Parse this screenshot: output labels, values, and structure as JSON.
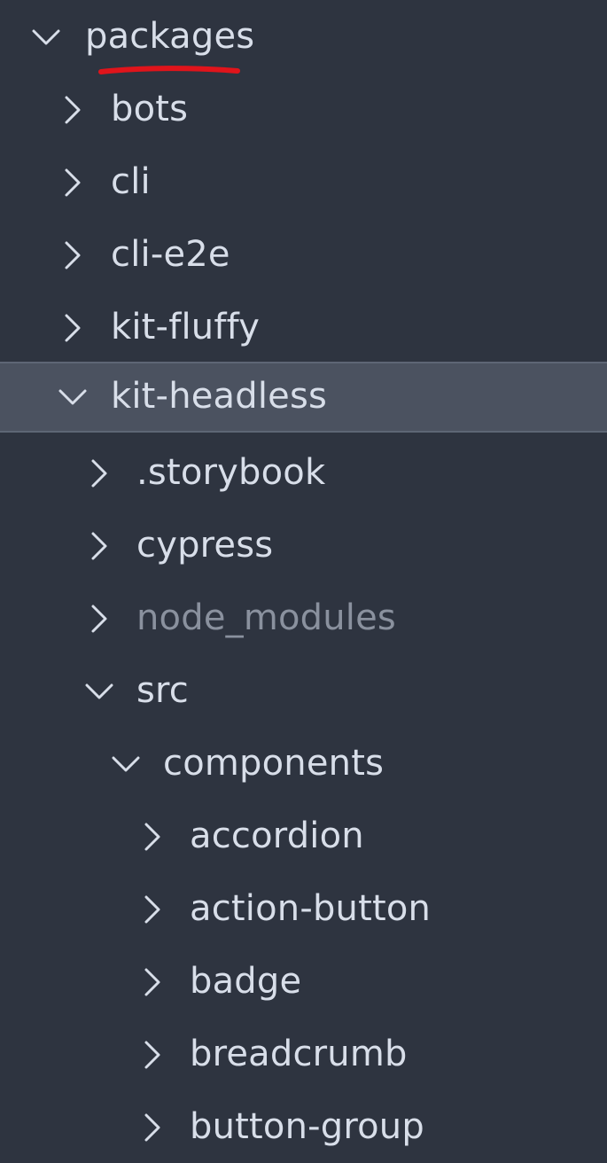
{
  "explorer": {
    "colors": {
      "background": "#2e3440",
      "text": "#d8dee9",
      "text_dim": "#8a919e",
      "selection": "#4b5260",
      "annotation": "#e0141b"
    },
    "items": [
      {
        "label": "packages",
        "expanded": true,
        "icon": "chevron-down-icon"
      },
      {
        "label": "bots",
        "expanded": false,
        "icon": "chevron-right-icon"
      },
      {
        "label": "cli",
        "expanded": false,
        "icon": "chevron-right-icon"
      },
      {
        "label": "cli-e2e",
        "expanded": false,
        "icon": "chevron-right-icon"
      },
      {
        "label": "kit-fluffy",
        "expanded": false,
        "icon": "chevron-right-icon"
      },
      {
        "label": "kit-headless",
        "expanded": true,
        "selected": true,
        "icon": "chevron-down-icon"
      },
      {
        "label": ".storybook",
        "expanded": false,
        "icon": "chevron-right-icon"
      },
      {
        "label": "cypress",
        "expanded": false,
        "icon": "chevron-right-icon"
      },
      {
        "label": "node_modules",
        "expanded": false,
        "ignored": true,
        "icon": "chevron-right-icon"
      },
      {
        "label": "src",
        "expanded": true,
        "icon": "chevron-down-icon"
      },
      {
        "label": "components",
        "expanded": true,
        "icon": "chevron-down-icon"
      },
      {
        "label": "accordion",
        "expanded": false,
        "icon": "chevron-right-icon"
      },
      {
        "label": "action-button",
        "expanded": false,
        "icon": "chevron-right-icon"
      },
      {
        "label": "badge",
        "expanded": false,
        "icon": "chevron-right-icon"
      },
      {
        "label": "breadcrumb",
        "expanded": false,
        "icon": "chevron-right-icon"
      },
      {
        "label": "button-group",
        "expanded": false,
        "icon": "chevron-right-icon"
      }
    ]
  }
}
